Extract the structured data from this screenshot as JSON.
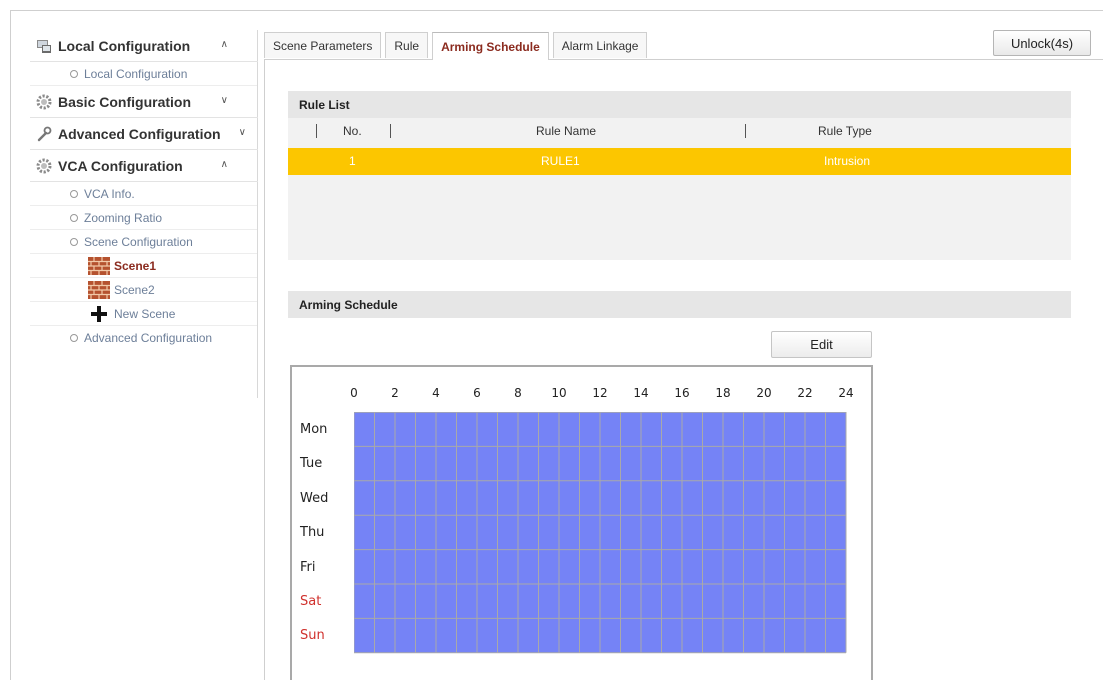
{
  "sidebar": {
    "sections": [
      {
        "label": "Local Configuration",
        "icon": "local-config-icon",
        "expanded": true,
        "items": [
          "Local Configuration"
        ]
      },
      {
        "label": "Basic Configuration",
        "icon": "gear-icon",
        "expanded": false
      },
      {
        "label": "Advanced Configuration",
        "icon": "wrench-icon",
        "expanded": false
      },
      {
        "label": "VCA Configuration",
        "icon": "gear-icon",
        "expanded": true,
        "items": [
          "VCA Info.",
          "Zooming Ratio",
          "Scene Configuration"
        ],
        "scenes": [
          "Scene1",
          "Scene2"
        ],
        "new_scene": "New Scene",
        "after": "Advanced Configuration"
      }
    ]
  },
  "tabs": [
    "Scene Parameters",
    "Rule",
    "Arming Schedule",
    "Alarm Linkage"
  ],
  "active_tab": "Arming Schedule",
  "unlock_label": "Unlock(4s)",
  "rule_list": {
    "title": "Rule List",
    "columns": [
      "No.",
      "Rule Name",
      "Rule Type"
    ],
    "rows": [
      {
        "no": "1",
        "name": "RULE1",
        "type": "Intrusion"
      }
    ]
  },
  "arming": {
    "title": "Arming Schedule",
    "edit_label": "Edit",
    "hours": [
      "0",
      "2",
      "4",
      "6",
      "8",
      "10",
      "12",
      "14",
      "16",
      "18",
      "20",
      "22",
      "24"
    ],
    "days": [
      "Mon",
      "Tue",
      "Wed",
      "Thu",
      "Fri",
      "Sat",
      "Sun"
    ],
    "weekend_days": [
      "Sat",
      "Sun"
    ],
    "schedule_color": "#7583f6",
    "weekend_color": "#d0312d",
    "highlight_color": "#fcc600"
  }
}
